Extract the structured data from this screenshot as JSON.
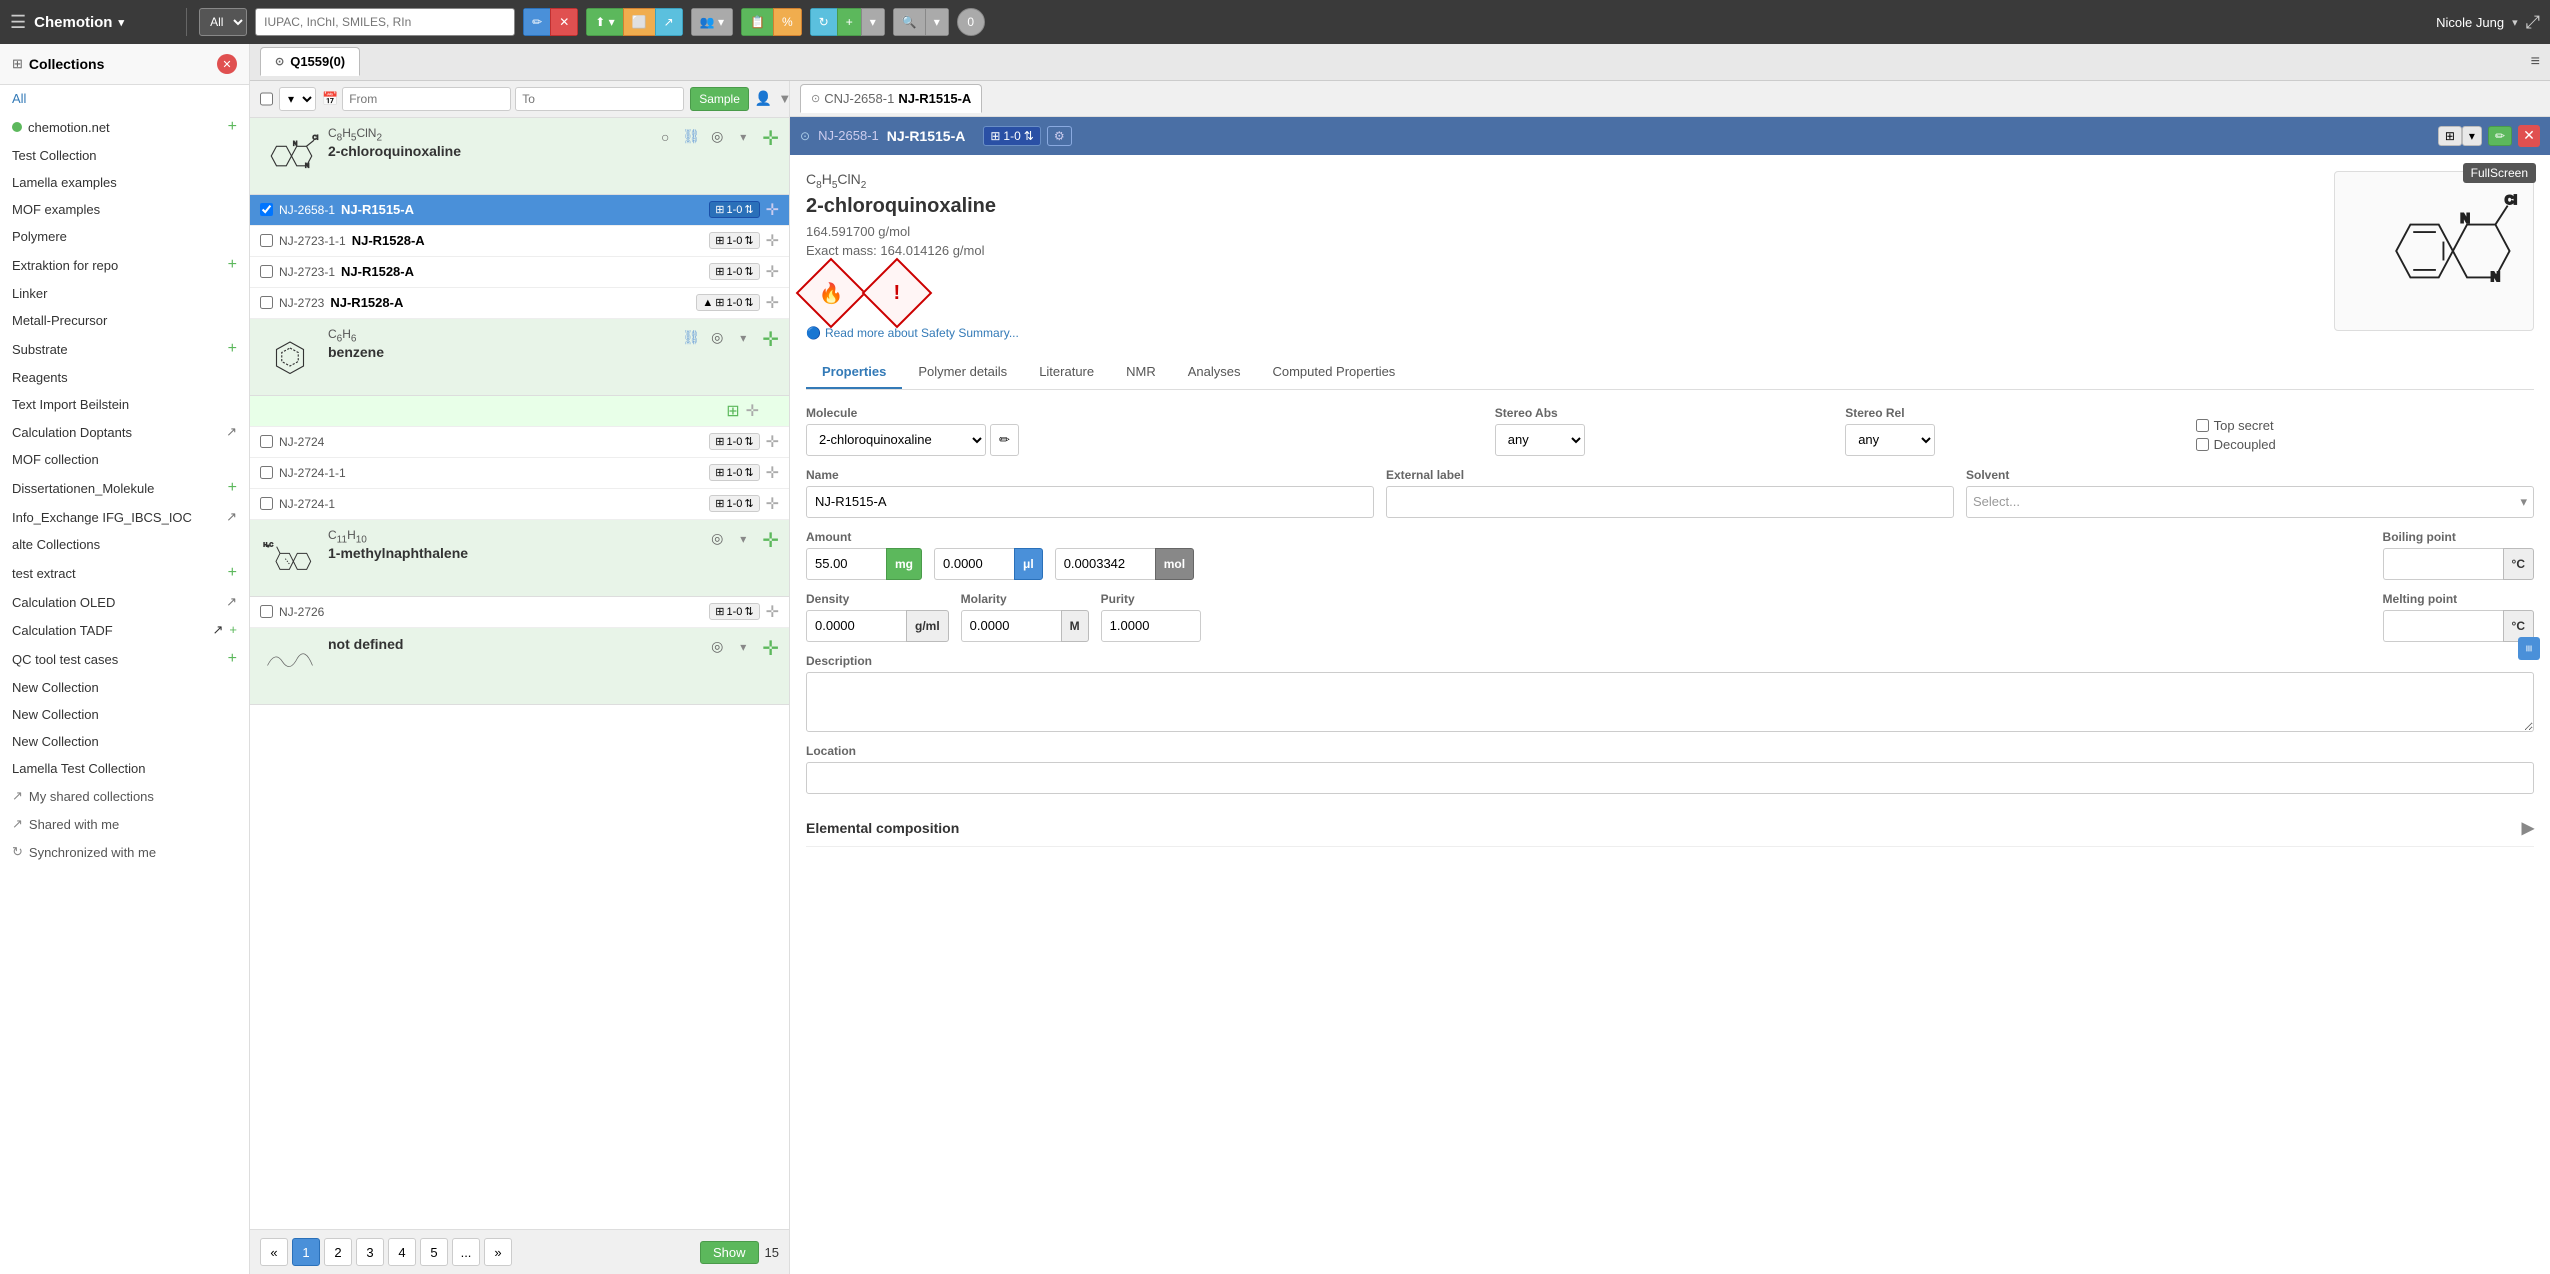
{
  "app": {
    "brand": "Chemotion",
    "brand_arrow": "▾",
    "user": "Nicole Jung",
    "user_arrow": "▾"
  },
  "toolbar": {
    "all_label": "All",
    "search_placeholder": "IUPAC, InChI, SMILES, RIn",
    "edit_icon": "✏️",
    "cancel_icon": "✕",
    "import_icon": "⬆",
    "clipboard_icon": "📋",
    "share_icon": "↗",
    "users_icon": "👥",
    "report_icon": "📄",
    "percent_icon": "%",
    "sync_icon": "↻",
    "plus_icon": "+",
    "zoom_icon": "🔍",
    "badge_zero": "0",
    "expand_icon": "⤢"
  },
  "sidebar": {
    "header_title": "Collections",
    "header_badge": "✕",
    "all_label": "All",
    "items": [
      {
        "id": "chemotion",
        "label": "chemotion.net",
        "dot_color": "#5cb85c",
        "has_plus": true
      },
      {
        "id": "test",
        "label": "Test Collection",
        "dot_color": null,
        "has_plus": false
      },
      {
        "id": "lamella",
        "label": "Lamella examples",
        "dot_color": null,
        "has_plus": false
      },
      {
        "id": "mof-ex",
        "label": "MOF examples",
        "dot_color": null,
        "has_plus": false
      },
      {
        "id": "polymere",
        "label": "Polymere",
        "dot_color": null,
        "has_plus": false
      },
      {
        "id": "extraktion",
        "label": "Extraktion for repo",
        "dot_color": null,
        "has_plus": true
      },
      {
        "id": "linker",
        "label": "Linker",
        "dot_color": null,
        "has_plus": false
      },
      {
        "id": "metall",
        "label": "Metall-Precursor",
        "dot_color": null,
        "has_plus": false
      },
      {
        "id": "substrate",
        "label": "Substrate",
        "dot_color": null,
        "has_plus": true
      },
      {
        "id": "reagents",
        "label": "Reagents",
        "dot_color": null,
        "has_plus": false
      },
      {
        "id": "text-import",
        "label": "Text Import Beilstein",
        "dot_color": null,
        "has_plus": false
      },
      {
        "id": "calc-dop",
        "label": "Calculation Doptants",
        "dot_color": null,
        "has_plus": false,
        "has_share": true
      },
      {
        "id": "mof-coll",
        "label": "MOF collection",
        "dot_color": null,
        "has_plus": false
      },
      {
        "id": "dissertationen",
        "label": "Dissertationen_Molekule",
        "dot_color": null,
        "has_plus": true
      },
      {
        "id": "info-exchange",
        "label": "Info_Exchange IFG_IBCS_IOC",
        "dot_color": null,
        "has_plus": false,
        "has_share": true
      },
      {
        "id": "alte",
        "label": "alte Collections",
        "dot_color": null,
        "has_plus": false
      },
      {
        "id": "test-extract",
        "label": "test extract",
        "dot_color": null,
        "has_plus": true
      },
      {
        "id": "calc-oled",
        "label": "Calculation OLED",
        "dot_color": null,
        "has_plus": false,
        "has_share": true
      },
      {
        "id": "calc-tadf",
        "label": "Calculation TADF",
        "dot_color": null,
        "has_plus": true,
        "has_share": true
      },
      {
        "id": "qc-tool",
        "label": "QC tool test cases",
        "dot_color": null,
        "has_plus": true
      },
      {
        "id": "new1",
        "label": "New Collection",
        "dot_color": null,
        "has_plus": false
      },
      {
        "id": "new2",
        "label": "New Collection",
        "dot_color": null,
        "has_plus": false
      },
      {
        "id": "new3",
        "label": "New Collection",
        "dot_color": null,
        "has_plus": false
      },
      {
        "id": "lamella-test",
        "label": "Lamella Test Collection",
        "dot_color": null,
        "has_plus": false
      }
    ],
    "shared_label": "My shared collections",
    "shared_with_me": "Shared with me",
    "sync_with_me": "Synchronized with me"
  },
  "content": {
    "tab_label": "Q1559(0)",
    "settings_icon": "≡"
  },
  "sample_list": {
    "from_label": "From",
    "to_label": "To",
    "sample_btn": "Sample",
    "scroll_label": "▼",
    "groups": [
      {
        "formula": "C₈H₅ClN₂",
        "name": "2-chloroquinoxaline",
        "rows": [
          {
            "id": "NJ-2658-1",
            "name": "NJ-R1515-A",
            "badge": "1-0",
            "selected": true
          },
          {
            "id": "NJ-2723-1-1",
            "name": "NJ-R1528-A",
            "badge": "1-0",
            "selected": false
          },
          {
            "id": "NJ-2723-1",
            "name": "NJ-R1528-A",
            "badge": "1-0",
            "selected": false
          },
          {
            "id": "NJ-2723",
            "name": "NJ-R1528-A",
            "badge": "1-0",
            "selected": false
          }
        ]
      },
      {
        "formula": "C₆H₆",
        "name": "benzene",
        "rows": [
          {
            "id": "NJ-2724",
            "name": "",
            "badge": "1-0",
            "selected": false
          },
          {
            "id": "NJ-2724-1-1",
            "name": "",
            "badge": "1-0",
            "selected": false
          },
          {
            "id": "NJ-2724-1",
            "name": "",
            "badge": "1-0",
            "selected": false
          }
        ]
      },
      {
        "formula": "C₁₁H₁₀",
        "name": "1-methylnaphthalene",
        "formula_prefix": "H₃C",
        "rows": [
          {
            "id": "NJ-2726",
            "name": "",
            "badge": "1-0",
            "selected": false
          }
        ]
      },
      {
        "formula": "",
        "name": "not defined",
        "rows": []
      }
    ],
    "pagination": {
      "prev": "«",
      "pages": [
        "1",
        "2",
        "3",
        "4",
        "5"
      ],
      "ellipsis": "...",
      "next": "»",
      "show_label": "Show",
      "per_page": "15"
    }
  },
  "detail": {
    "outer_tab_id": "CNJ-2658-1",
    "outer_tab_name": "NJ-R1515-A",
    "tab_id": "NJ-2658-1",
    "tab_name": "NJ-R1515-A",
    "badge": "1-0",
    "formula": "C₈H₅ClN₂",
    "mol_name": "2-chloroquinoxaline",
    "mw": "164.591700 g/mol",
    "exact_mass": "Exact mass: 164.014126 g/mol",
    "fullscreen_tooltip": "FullScreen",
    "tabs": [
      "Properties",
      "Polymer details",
      "Literature",
      "NMR",
      "Analyses",
      "Computed Properties"
    ],
    "active_tab": "Properties",
    "molecule_label": "Molecule",
    "stereo_abs_label": "Stereo Abs",
    "stereo_rel_label": "Stereo Rel",
    "molecule_value": "2-chloroquinoxaline",
    "stereo_abs_value": "any",
    "stereo_rel_value": "any",
    "top_secret_label": "Top secret",
    "decoupled_label": "Decoupled",
    "name_label": "Name",
    "external_label": "External label",
    "solvent_label": "Solvent",
    "name_value": "NJ-R1515-A",
    "external_value": "",
    "solvent_placeholder": "Select...",
    "amount_label": "Amount",
    "amount_value": "55.00",
    "amount_unit": "mg",
    "amount_ul": "0.0000",
    "amount_ul_unit": "μl",
    "amount_mol": "0.0003342",
    "amount_mol_unit": "mol",
    "boiling_label": "Boiling point",
    "boiling_unit": "°C",
    "density_label": "Density",
    "density_value": "0.0000",
    "density_unit": "g/ml",
    "molarity_label": "Molarity",
    "molarity_value": "0.0000",
    "molarity_unit": "M",
    "purity_label": "Purity",
    "purity_value": "1.0000",
    "melting_label": "Melting point",
    "melting_unit": "°C",
    "description_label": "Description",
    "location_label": "Location",
    "elemental_label": "Elemental composition",
    "select_placeholder": "Select"
  }
}
